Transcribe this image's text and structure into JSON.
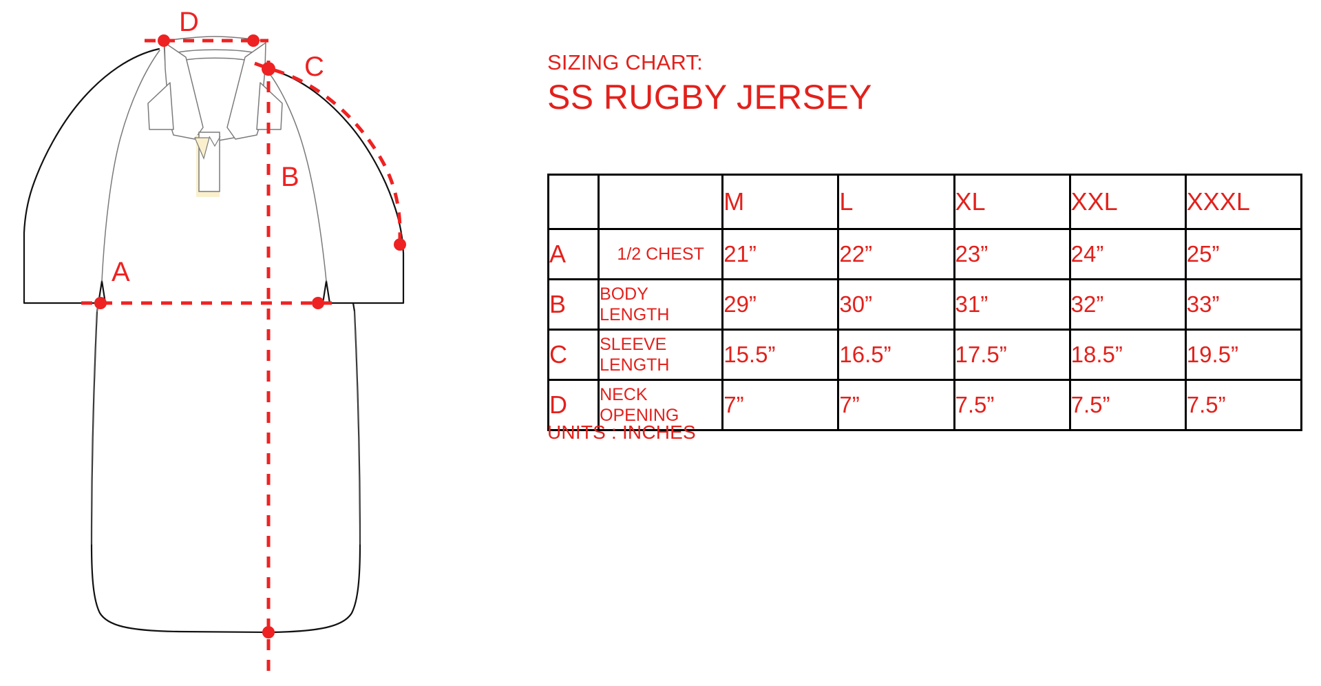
{
  "header": {
    "title_line1": "SIZING CHART:",
    "title_line2": "SS RUGBY JERSEY"
  },
  "footer": {
    "units": "UNITS : INCHES"
  },
  "colors": {
    "accent_red": "#e2211c",
    "table_border": "#000000",
    "garment_outline": "#000000",
    "garment_detail": "#6b6b6b",
    "placket_accent": "#faf0cd"
  },
  "illustration": {
    "alt": "front view technical flat of short sleeve rugby jersey with measurement guides",
    "labels": {
      "a": "A",
      "b": "B",
      "c": "C",
      "d": "D"
    },
    "label_meanings": {
      "a": "1/2 CHEST",
      "b": "BODY LENGTH",
      "c": "SLEEVE LENGTH",
      "d": "NECK OPENING"
    }
  },
  "chart_data": {
    "type": "table",
    "title": "SIZING CHART: SS RUGBY JERSEY",
    "units": "INCHES",
    "columns": [
      "",
      "",
      "M",
      "L",
      "XL",
      "XXL",
      "XXXL"
    ],
    "sizes": [
      "M",
      "L",
      "XL",
      "XXL",
      "XXXL"
    ],
    "rows": [
      {
        "letter": "A",
        "measurement": "1/2 CHEST",
        "measurement_lines": [
          "1/2 CHEST"
        ],
        "values": [
          "21”",
          "22”",
          "23”",
          "24”",
          "25”"
        ],
        "numeric": [
          21,
          22,
          23,
          24,
          25
        ]
      },
      {
        "letter": "B",
        "measurement": "BODY LENGTH",
        "measurement_lines": [
          "BODY",
          "LENGTH"
        ],
        "values": [
          "29”",
          "30”",
          "31”",
          "32”",
          "33”"
        ],
        "numeric": [
          29,
          30,
          31,
          32,
          33
        ]
      },
      {
        "letter": "C",
        "measurement": "SLEEVE LENGTH",
        "measurement_lines": [
          "SLEEVE",
          "LENGTH"
        ],
        "values": [
          "15.5”",
          "16.5”",
          "17.5”",
          "18.5”",
          "19.5”"
        ],
        "numeric": [
          15.5,
          16.5,
          17.5,
          18.5,
          19.5
        ]
      },
      {
        "letter": "D",
        "measurement": "NECK OPENING",
        "measurement_lines": [
          "NECK",
          "OPENING"
        ],
        "values": [
          "7”",
          "7”",
          "7.5”",
          "7.5”",
          "7.5”"
        ],
        "numeric": [
          7,
          7,
          7.5,
          7.5,
          7.5
        ]
      }
    ]
  }
}
